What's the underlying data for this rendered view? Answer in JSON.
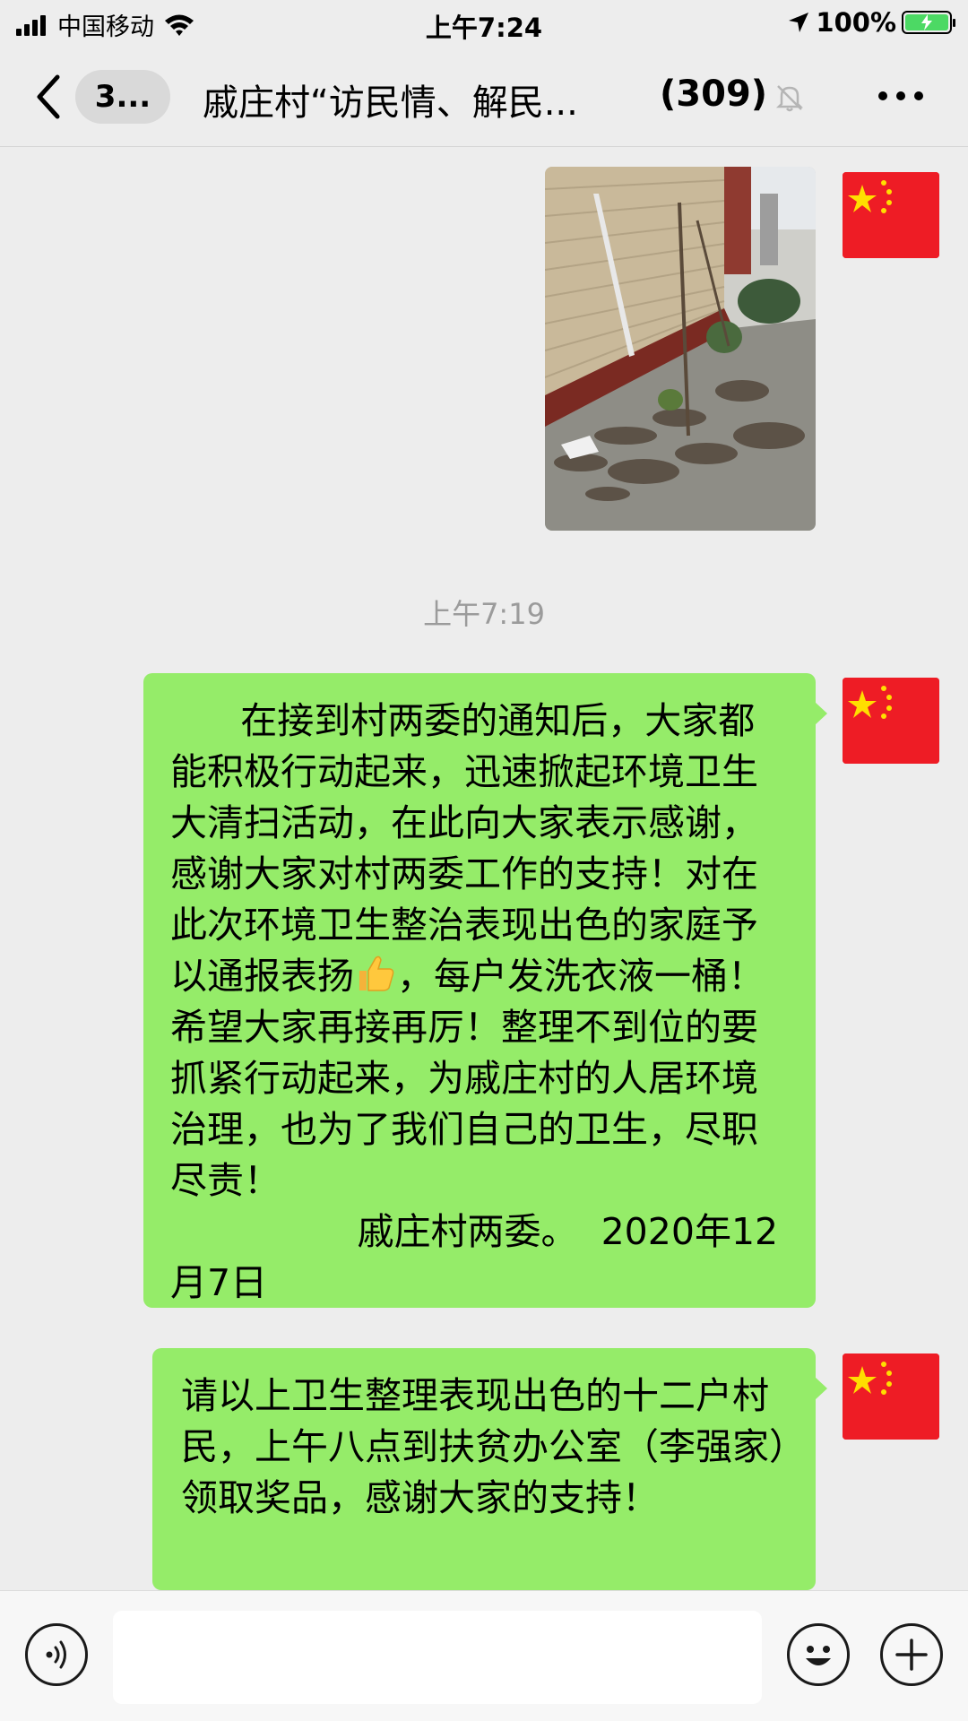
{
  "status_bar": {
    "carrier": "中国移动",
    "time": "上午7:24",
    "battery": "100%",
    "icons": [
      "signal-icon",
      "wifi-icon",
      "location-arrow-icon",
      "battery-charging-icon"
    ]
  },
  "nav": {
    "back_badge": "3...",
    "title": "戚庄村“访民情、解民...",
    "member_count": "(309)",
    "icons": [
      "chevron-left-icon",
      "mute-bell-icon",
      "more-dots-icon"
    ]
  },
  "messages": {
    "timestamp": "上午7:19",
    "msg1_part1": "      在接到村两委的通知后，大家都能积极行动起来，迅速掀起环境卫生大清扫活动，在此向大家表示感谢，感谢大家对村两委工作的支持！对在此次环境卫生整治表现出色的家庭予以通报表扬",
    "msg1_part2": "，每户发洗衣液一桶！希望大家再接再厉！整理不到位的要抓紧行动起来，为戚庄村的人居环境治理，也为了我们自己的卫生，尽职尽责！\n                戚庄村两委。  2020年12月7日",
    "msg2": "请以上卫生整理表现出色的十二户村民，上午八点到扶贫办公室（李强家）领取奖品，感谢大家的支持！",
    "emoji": "thumbs-up-icon",
    "avatar_icon": "china-flag-avatar-icon"
  },
  "input_bar": {
    "text_value": "",
    "icons": [
      "voice-icon",
      "emoji-face-icon",
      "plus-icon"
    ]
  },
  "colors": {
    "bubble": "#95ec69",
    "background": "#ededed",
    "flag_red": "#ee1c25",
    "flag_star": "#ffde00"
  }
}
